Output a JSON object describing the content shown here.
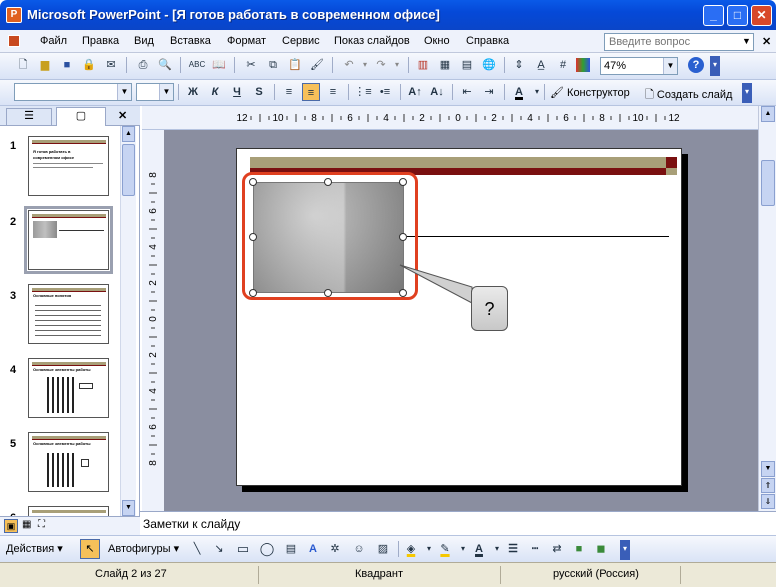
{
  "window": {
    "title": "Microsoft PowerPoint - [Я готов работать в современном офисе]"
  },
  "menu": {
    "items": [
      "Файл",
      "Правка",
      "Вид",
      "Вставка",
      "Формат",
      "Сервис",
      "Показ слайдов",
      "Окно",
      "Справка"
    ],
    "help_placeholder": "Введите вопрос"
  },
  "standard_toolbar": {
    "zoom": "47%"
  },
  "formatting_toolbar": {
    "bold": "Ж",
    "italic": "К",
    "underline": "Ч",
    "shadow": "S",
    "designer": "Конструктор",
    "new_slide": "Создать слайд"
  },
  "slides_pane": {
    "slides": [
      {
        "num": "1",
        "title": "Я готов работать в современном офисе"
      },
      {
        "num": "2",
        "title": ""
      },
      {
        "num": "3",
        "title": "Основные понятия"
      },
      {
        "num": "4",
        "title": "Основные элементы работы"
      },
      {
        "num": "5",
        "title": "Основные элементы работы"
      },
      {
        "num": "6",
        "title": ""
      }
    ]
  },
  "ruler": {
    "h_labels": [
      "12",
      "10",
      "8",
      "6",
      "4",
      "2",
      "0",
      "2",
      "4",
      "6",
      "8",
      "10",
      "12"
    ],
    "v_labels": [
      "8",
      "6",
      "4",
      "2",
      "0",
      "2",
      "4",
      "6",
      "8"
    ]
  },
  "callout": {
    "text": "?"
  },
  "notes": {
    "placeholder": "Заметки к слайду"
  },
  "drawing_toolbar": {
    "actions": "Действия",
    "autoshapes": "Автофигуры"
  },
  "statusbar": {
    "slide": "Слайд 2 из 27",
    "design": "Квадрант",
    "language": "русский (Россия)"
  },
  "colors": {
    "accent_bar": "#a89f78",
    "dark_red": "#7a1010",
    "selection": "#e04020"
  }
}
